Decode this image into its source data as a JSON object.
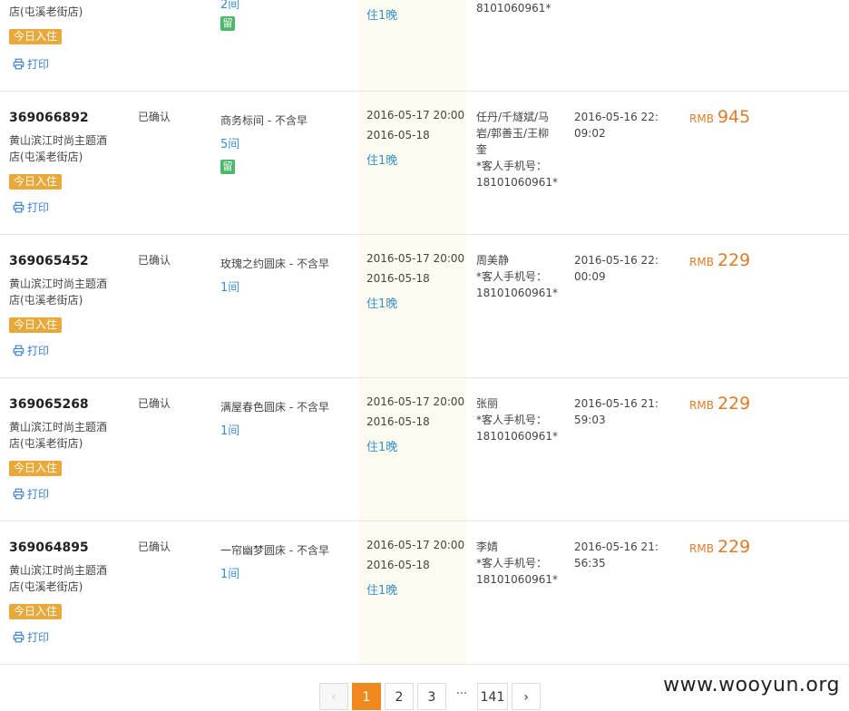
{
  "top_row": {
    "hotel_tail": "店(屯溪老街店)",
    "rooms": "2间",
    "liu": "留",
    "nights": "住1晚",
    "guest_tail": "8101060961*",
    "today_label": "今日入住",
    "print_label": "打印"
  },
  "orders": [
    {
      "id": "369066892",
      "status": "已确认",
      "hotel": "黄山滨江时尚主题酒店(屯溪老街店)",
      "today_label": "今日入住",
      "print_label": "打印",
      "room_type": "商务标间 - 不含早",
      "rooms": "5间",
      "liu": "留",
      "checkin": "2016-05-17 20:00",
      "checkout": "2016-05-18",
      "nights": "住1晚",
      "guest": "任丹/千燧斌/马岩/郭善玉/王柳奎",
      "phone": "*客人手机号：18101060961*",
      "booked_at": "2016-05-16 22:09:02",
      "currency": "RMB",
      "price": "945"
    },
    {
      "id": "369065452",
      "status": "已确认",
      "hotel": "黄山滨江时尚主题酒店(屯溪老街店)",
      "today_label": "今日入住",
      "print_label": "打印",
      "room_type": "玫瑰之约圆床 - 不含早",
      "rooms": "1间",
      "checkin": "2016-05-17 20:00",
      "checkout": "2016-05-18",
      "nights": "住1晚",
      "guest": "周美静",
      "phone": "*客人手机号：18101060961*",
      "booked_at": "2016-05-16 22:00:09",
      "currency": "RMB",
      "price": "229"
    },
    {
      "id": "369065268",
      "status": "已确认",
      "hotel": "黄山滨江时尚主题酒店(屯溪老街店)",
      "today_label": "今日入住",
      "print_label": "打印",
      "room_type": "满屋春色圆床 - 不含早",
      "rooms": "1间",
      "checkin": "2016-05-17 20:00",
      "checkout": "2016-05-18",
      "nights": "住1晚",
      "guest": "张丽",
      "phone": "*客人手机号：18101060961*",
      "booked_at": "2016-05-16 21:59:03",
      "currency": "RMB",
      "price": "229"
    },
    {
      "id": "369064895",
      "status": "已确认",
      "hotel": "黄山滨江时尚主题酒店(屯溪老街店)",
      "today_label": "今日入住",
      "print_label": "打印",
      "room_type": "一帘幽梦圆床 - 不含早",
      "rooms": "1间",
      "checkin": "2016-05-17 20:00",
      "checkout": "2016-05-18",
      "nights": "住1晚",
      "guest": "李婧",
      "phone": "*客人手机号：18101060961*",
      "booked_at": "2016-05-16 21:56:35",
      "currency": "RMB",
      "price": "229"
    }
  ],
  "pagination": {
    "prev": "‹",
    "pages": [
      "1",
      "2",
      "3"
    ],
    "ellipsis": "···",
    "last": "141",
    "next": "›"
  },
  "watermark": "www.wooyun.org",
  "colors": {
    "accent_orange": "#f08a1c",
    "price": "#e07b2a",
    "link_blue": "#3a90c8",
    "badge": "#e8a83a",
    "liu_green": "#4bb86a"
  }
}
